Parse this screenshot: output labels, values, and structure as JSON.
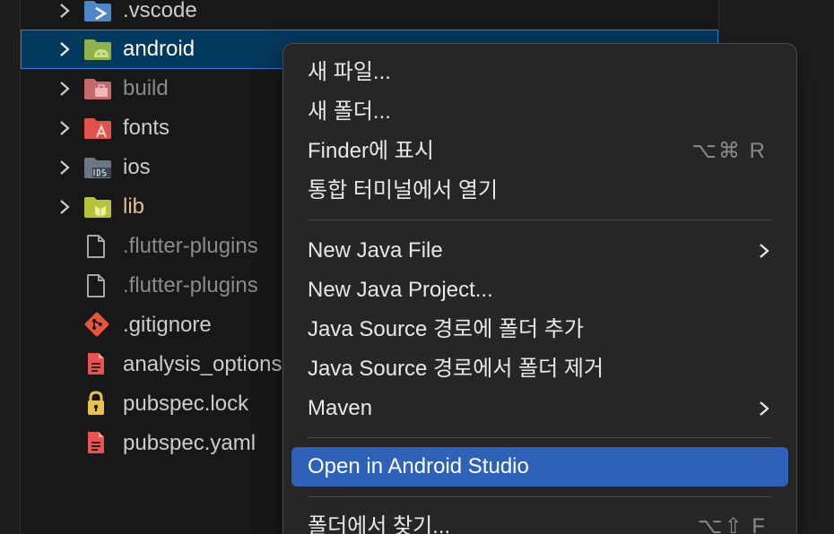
{
  "explorer": {
    "items": [
      {
        "label": ".vscode",
        "icon": "vscode-folder-icon",
        "type": "folder"
      },
      {
        "label": "android",
        "icon": "android-folder-icon",
        "type": "folder",
        "selected": true
      },
      {
        "label": "build",
        "icon": "build-folder-icon",
        "type": "folder"
      },
      {
        "label": "fonts",
        "icon": "fonts-folder-icon",
        "type": "folder"
      },
      {
        "label": "ios",
        "icon": "ios-folder-icon",
        "type": "folder"
      },
      {
        "label": "lib",
        "icon": "lib-folder-icon",
        "type": "folder"
      },
      {
        "label": ".flutter-plugins",
        "icon": "file-icon",
        "type": "file"
      },
      {
        "label": ".flutter-plugins",
        "icon": "file-icon",
        "type": "file"
      },
      {
        "label": ".gitignore",
        "icon": "git-icon",
        "type": "file"
      },
      {
        "label": "analysis_options.yaml",
        "icon": "yaml-file-icon",
        "type": "file"
      },
      {
        "label": "pubspec.lock",
        "icon": "lock-icon",
        "type": "file"
      },
      {
        "label": "pubspec.yaml",
        "icon": "yaml-file-icon",
        "type": "file"
      }
    ]
  },
  "context_menu": {
    "items": [
      {
        "label": "새 파일..."
      },
      {
        "label": "새 폴더..."
      },
      {
        "label": "Finder에 표시",
        "shortcut": "⌥⌘ R"
      },
      {
        "label": "통합 터미널에서 열기"
      },
      {
        "label": "New Java File",
        "submenu": true
      },
      {
        "label": "New Java Project..."
      },
      {
        "label": "Java Source 경로에 폴더 추가"
      },
      {
        "label": "Java Source 경로에서 폴더 제거"
      },
      {
        "label": "Maven",
        "submenu": true
      },
      {
        "label": "Open in Android Studio",
        "highlighted": true
      },
      {
        "label": "폴더에서 찾기...",
        "shortcut": "⌥⇧ F"
      }
    ]
  },
  "colors": {
    "selection": "#04395e",
    "selection_border": "#3b7ddd",
    "menu_highlight": "#2d62b8",
    "menu_background": "#262626"
  }
}
